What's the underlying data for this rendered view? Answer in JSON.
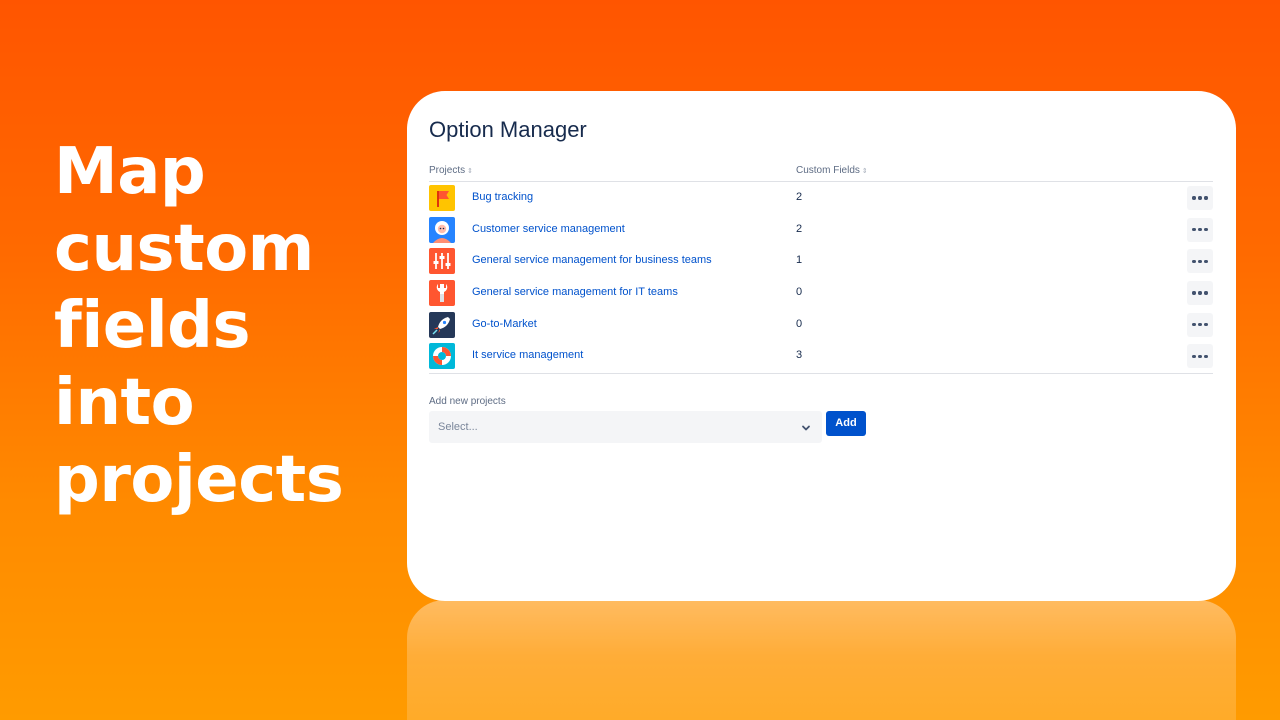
{
  "headline": {
    "lines": [
      "Map",
      "custom",
      "fields into",
      "projects"
    ]
  },
  "colors": {
    "background_top": "#ff5500",
    "background_bottom": "#ff9b00",
    "link": "#0052cc",
    "primary_button": "#0052cc",
    "title_text": "#172b4d"
  },
  "panel": {
    "title": "Option Manager",
    "columns": {
      "projects": "Projects",
      "custom_fields": "Custom Fields",
      "sort_indicator": "⇕"
    },
    "rows": [
      {
        "name": "Bug tracking",
        "count": "2",
        "icon": "flag-icon"
      },
      {
        "name": "Customer service management",
        "count": "2",
        "icon": "avatar-icon"
      },
      {
        "name": "General service management for business teams",
        "count": "1",
        "icon": "sliders-icon"
      },
      {
        "name": "General service management for IT teams",
        "count": "0",
        "icon": "wrench-icon"
      },
      {
        "name": "Go-to-Market",
        "count": "0",
        "icon": "rocket-icon"
      },
      {
        "name": "It service management",
        "count": "3",
        "icon": "lifebuoy-icon"
      }
    ],
    "row_action_icon": "more-horizontal-icon",
    "add_projects": {
      "label": "Add new projects",
      "placeholder": "Select...",
      "button": "Add"
    }
  }
}
